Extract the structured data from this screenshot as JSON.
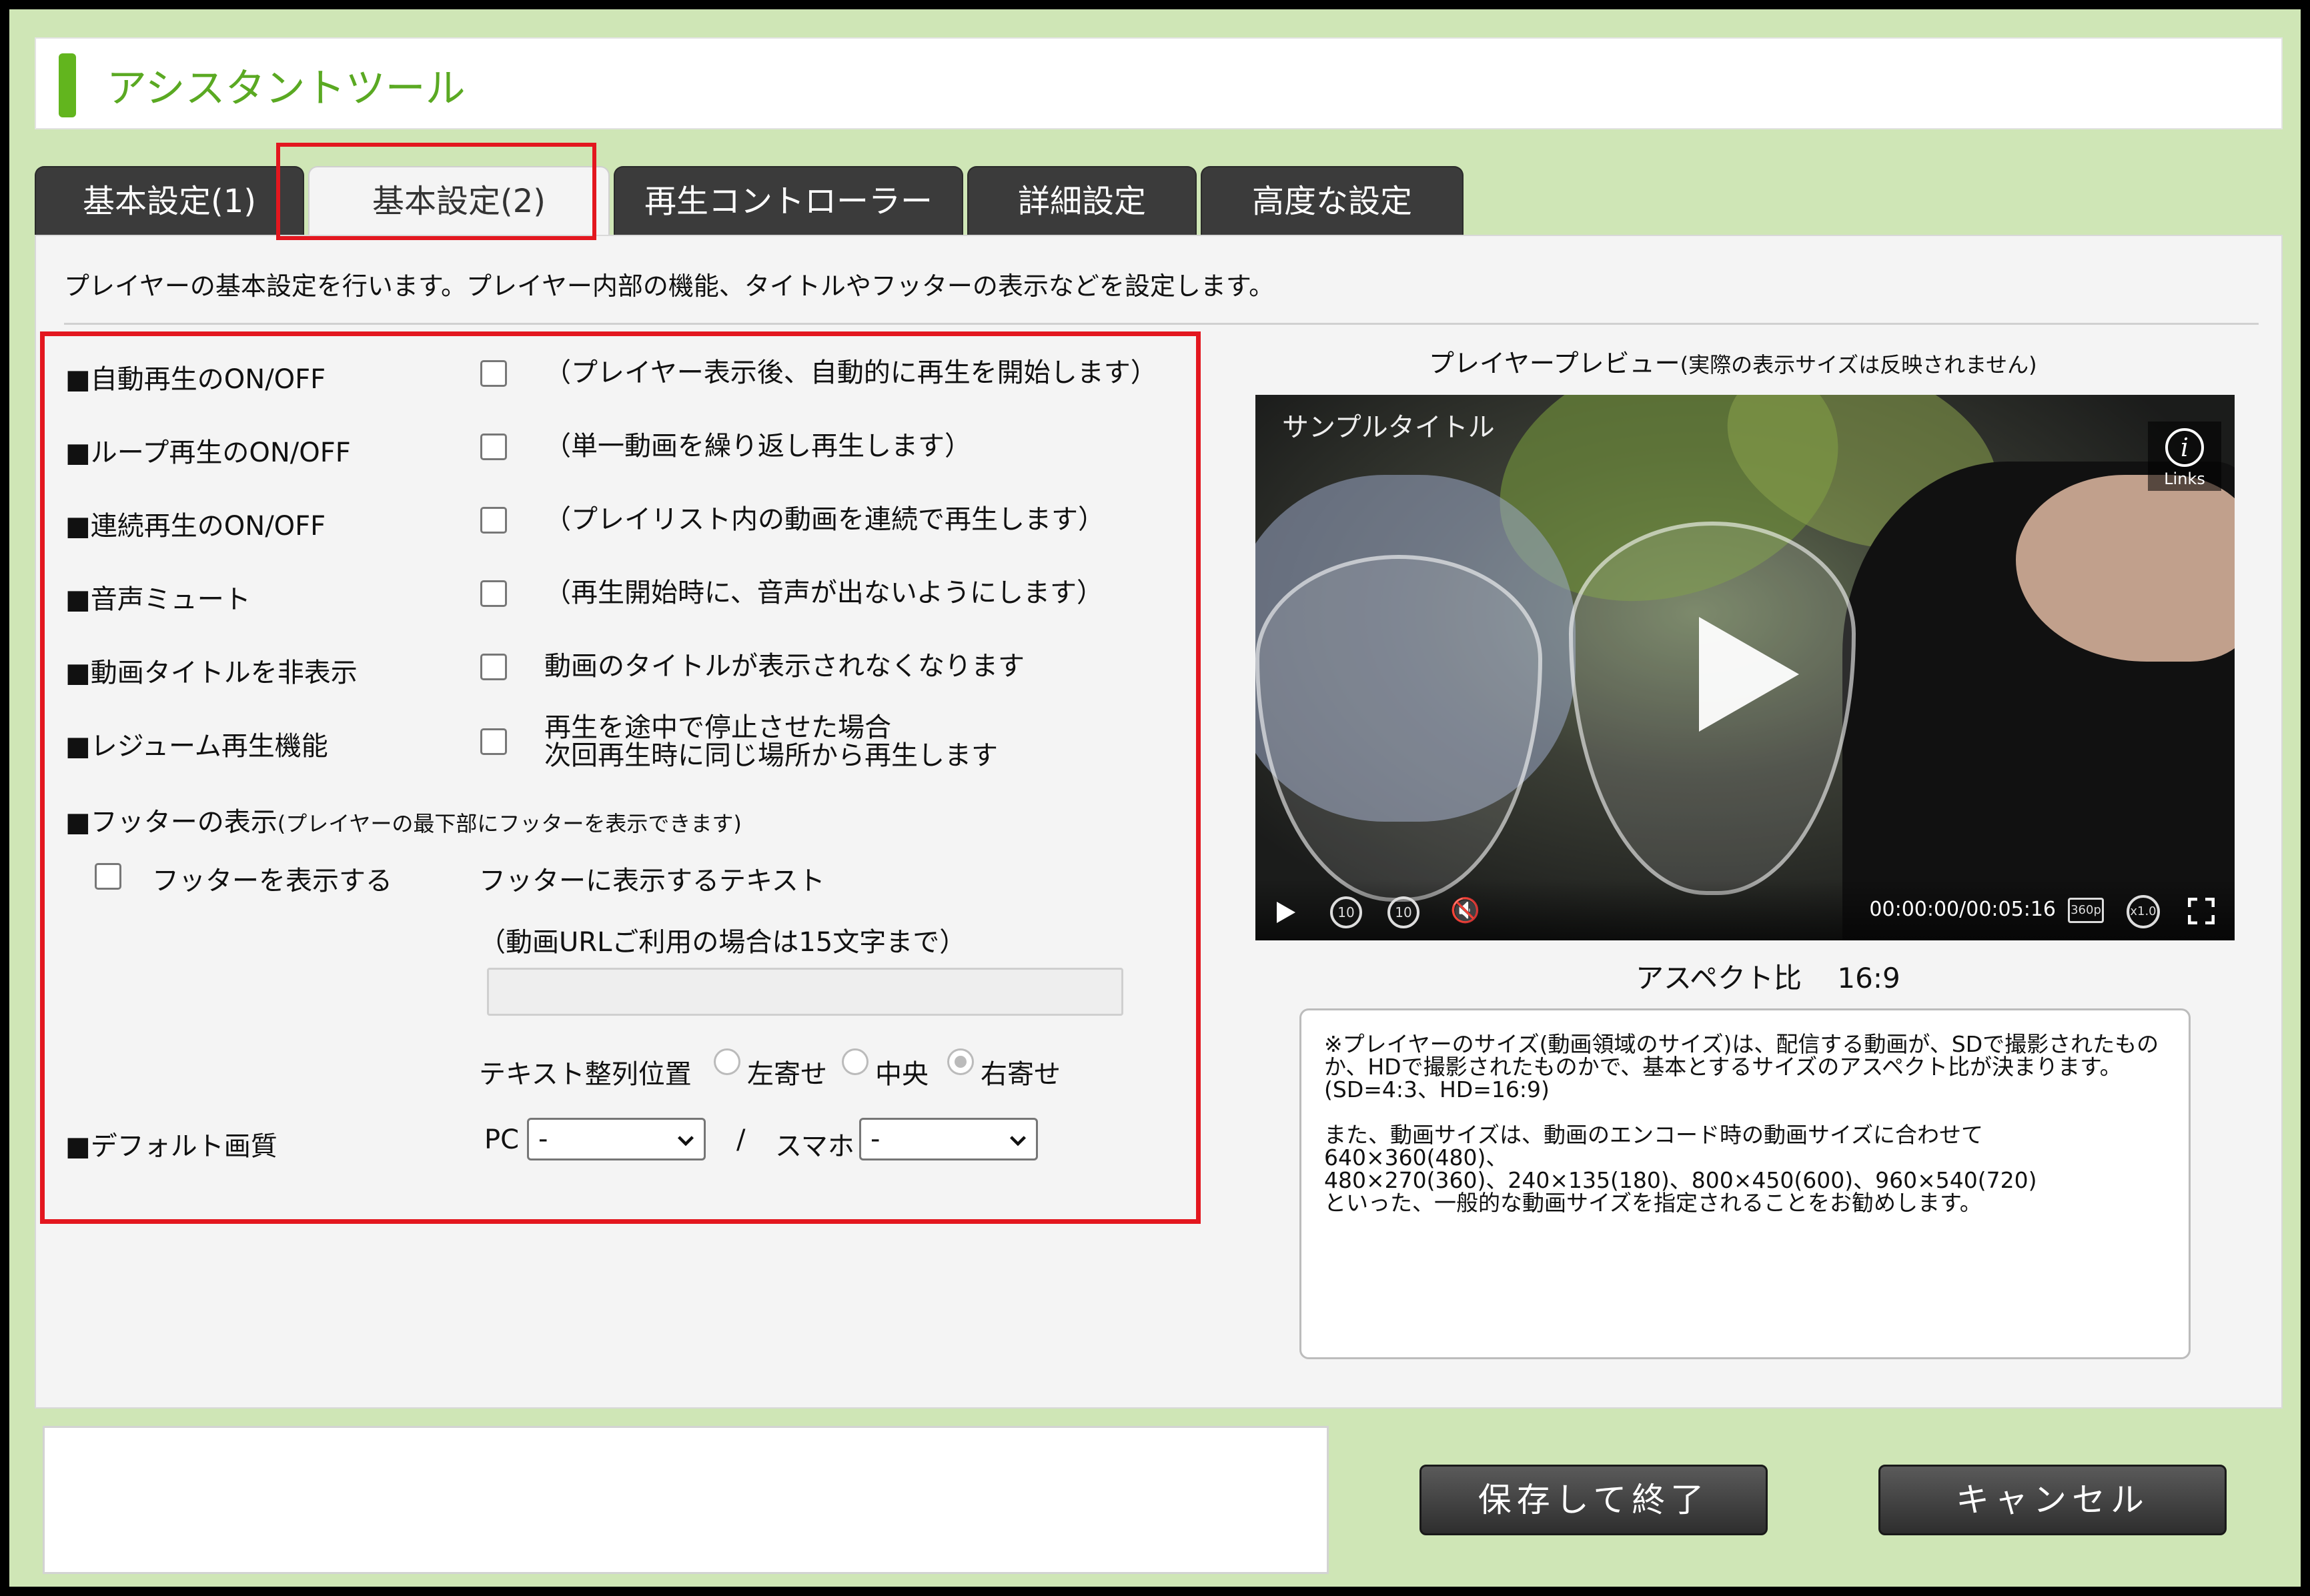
{
  "app": {
    "title": "アシスタントツール"
  },
  "tabs": [
    {
      "label": "基本設定(1)"
    },
    {
      "label": "基本設定(2)",
      "active": true
    },
    {
      "label": "再生コントローラー"
    },
    {
      "label": "詳細設定"
    },
    {
      "label": "高度な設定"
    }
  ],
  "intro": "プレイヤーの基本設定を行います。プレイヤー内部の機能、タイトルやフッターの表示などを設定します。",
  "settings": {
    "autoplay": {
      "label": "■自動再生のON/OFF",
      "desc": "（プレイヤー表示後、自動的に再生を開始します）",
      "checked": false
    },
    "loop": {
      "label": "■ループ再生のON/OFF",
      "desc": "（単一動画を繰り返し再生します）",
      "checked": false
    },
    "continuous": {
      "label": "■連続再生のON/OFF",
      "desc": "（プレイリスト内の動画を連続で再生します）",
      "checked": false
    },
    "mute": {
      "label": "■音声ミュート",
      "desc": "（再生開始時に、音声が出ないようにします）",
      "checked": false
    },
    "hide_title": {
      "label": "■動画タイトルを非表示",
      "desc": "動画のタイトルが表示されなくなります",
      "checked": false
    },
    "resume": {
      "label": "■レジューム再生機能",
      "desc_line1": "再生を途中で停止させた場合",
      "desc_line2": "次回再生時に同じ場所から再生します",
      "checked": false
    },
    "footer": {
      "label": "■フッターの表示",
      "label_note": "(プレイヤーの最下部にフッターを表示できます)",
      "show_label": "フッターを表示する",
      "show_checked": false,
      "text_label": "フッターに表示するテキスト",
      "text_note": "（動画URLご利用の場合は15文字まで）",
      "text_value": "",
      "align_label": "テキスト整列位置",
      "align_options": [
        "左寄せ",
        "中央",
        "右寄せ"
      ],
      "align_selected": "右寄せ"
    },
    "quality": {
      "label": "■デフォルト画質",
      "pc_label": "PC",
      "pc_value": "-",
      "separator": "/",
      "sp_label": "スマホ",
      "sp_value": "-"
    }
  },
  "preview": {
    "caption_main": "プレイヤープレビュー",
    "caption_note": "(実際の表示サイズは反映されません)",
    "video_title": "サンプルタイトル",
    "links_label": "Links",
    "time": "00:00:00/00:05:16",
    "skip_back": "10",
    "skip_fwd": "10",
    "quality_badge": "360p",
    "speed_badge": "x1.0",
    "aspect_label": "アスペクト比",
    "aspect_value": "16:9"
  },
  "notes": "※プレイヤーのサイズ(動画領域のサイズ)は、配信する動画が、SDで撮影されたもの\nか、HDで撮影されたものかで、基本とするサイズのアスペクト比が決まります。\n(SD=4:3、HD=16:9)\n\nまた、動画サイズは、動画のエンコード時の動画サイズに合わせて640×360(480)、\n480×270(360)、240×135(180)、800×450(600)、960×540(720)\nといった、一般的な動画サイズを指定されることをお勧めします。",
  "buttons": {
    "save": "保存して終了",
    "cancel": "キャンセル"
  },
  "colors": {
    "accent_green": "#62b51e",
    "highlight_red": "#e3171f",
    "frame_bg": "#cfe6b6"
  }
}
